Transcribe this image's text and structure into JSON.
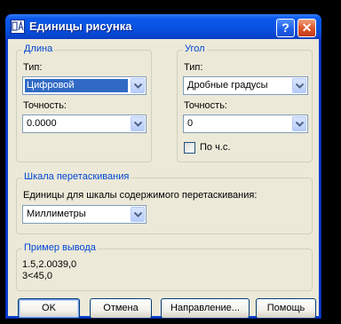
{
  "window": {
    "title": "Единицы рисунка",
    "help_label": "?",
    "close_label": "✕"
  },
  "length": {
    "group_title": "Длина",
    "type_label": "Тип:",
    "type_value": "Цифровой",
    "precision_label": "Точность:",
    "precision_value": "0.0000"
  },
  "angle": {
    "group_title": "Угол",
    "type_label": "Тип:",
    "type_value": "Дробные градусы",
    "precision_label": "Точность:",
    "precision_value": "0",
    "clockwise_label": "По ч.с.",
    "clockwise_checked": false
  },
  "scale": {
    "group_title": "Шкала перетаскивания",
    "units_label": "Единицы для шкалы содержимого перетаскивания:",
    "units_value": "Миллиметры"
  },
  "sample": {
    "group_title": "Пример вывода",
    "line1": "1.5,2.0039,0",
    "line2": "3<45,0"
  },
  "buttons": {
    "ok": "OK",
    "cancel": "Отмена",
    "direction": "Направление...",
    "help": "Помощь"
  },
  "colors": {
    "title_bar": "#0a58ea",
    "dialog_bg": "#ece9d8",
    "group_title": "#0046d5",
    "selection": "#316ac5",
    "close_button": "#e0582c"
  }
}
